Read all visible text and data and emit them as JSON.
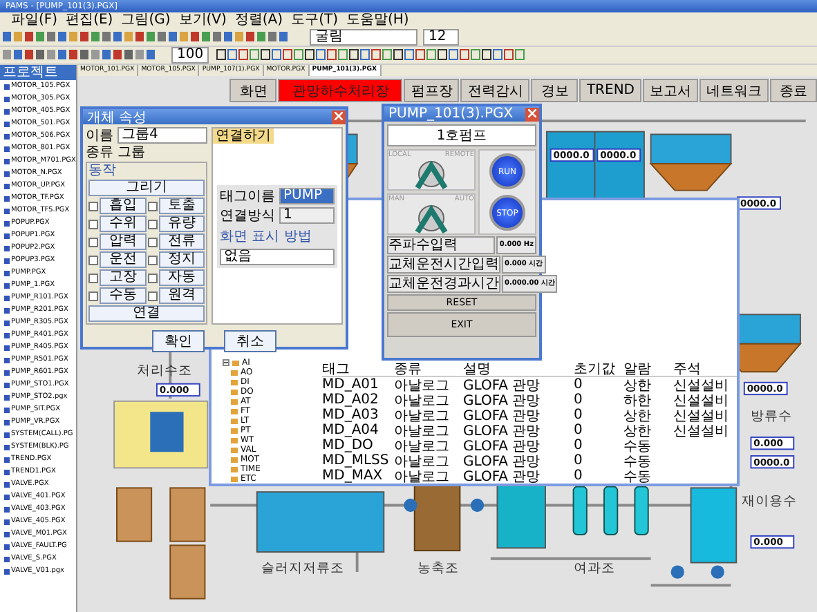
{
  "window": {
    "title": "PAMS - [PUMP_101(3).PGX]"
  },
  "menu": [
    "파일(F)",
    "편집(E)",
    "그림(G)",
    "보기(V)",
    "정렬(A)",
    "도구(T)",
    "도움말(H)"
  ],
  "toolbar": {
    "font_field": "굴림",
    "size_field": "12",
    "zoom_field": "100"
  },
  "doc_tabs": [
    {
      "label": "MOTOR_101.PGX",
      "selected": false
    },
    {
      "label": "MOTOR_105.PGX",
      "selected": false
    },
    {
      "label": "PUMP_107(1).PGX",
      "selected": false
    },
    {
      "label": "MOTOR.PGX",
      "selected": false
    },
    {
      "label": "PUMP_101(3).PGX",
      "selected": true
    }
  ],
  "project_panel": {
    "title": "프로젝트",
    "files": [
      "MOTOR_105.PGX",
      "MOTOR_305.PGX",
      "MOTOR_405.PGX",
      "MOTOR_501.PGX",
      "MOTOR_506.PGX",
      "MOTOR_801.PGX",
      "MOTOR_M701.PGX",
      "MOTOR_N.PGX",
      "MOTOR_UP.PGX",
      "MOTOR_TF.PGX",
      "MOTOR_TFS.PGX",
      "POPUP.PGX",
      "POPUP1.PGX",
      "POPUP2.PGX",
      "POPUP3.PGX",
      "PUMP.PGX",
      "PUMP_1.PGX",
      "PUMP_R101.PGX",
      "PUMP_R201.PGX",
      "PUMP_R305.PGX",
      "PUMP_R401.PGX",
      "PUMP_R405.PGX",
      "PUMP_R501.PGX",
      "PUMP_R601.PGX",
      "PUMP_STO1.PGX",
      "PUMP_STO2.pgx",
      "PUMP_SIT.PGX",
      "PUMP_VR.PGX",
      "SYSTEM(CALL).PG",
      "SYSTEM(BLK).PG",
      "TREND.PGX",
      "TREND1.PGX",
      "VALVE.PGX",
      "VALVE_401.PGX",
      "VALVE_403.PGX",
      "VALVE_405.PGX",
      "VALVE_M01.PGX",
      "VALVE_FAULT.PG",
      "VALVE_S.PGX",
      "VALVE_V01.pgx"
    ]
  },
  "nav_buttons": [
    {
      "label": "화면",
      "selected": false
    },
    {
      "label": "관망하수처리장",
      "selected": true
    },
    {
      "label": "펌프장",
      "selected": false
    },
    {
      "label": "전력감시",
      "selected": false
    },
    {
      "label": "경보",
      "selected": false
    },
    {
      "label": "TREND",
      "selected": false
    },
    {
      "label": "보고서",
      "selected": false
    },
    {
      "label": "네트워크",
      "selected": false
    },
    {
      "label": "종료",
      "selected": false
    }
  ],
  "property_dialog": {
    "title": "개체 속성",
    "name_label": "이름",
    "name_value": "그룹4",
    "type_label": "종류",
    "type_value": "그룹",
    "group_label": "동작",
    "header_button": "그리기",
    "options": [
      {
        "label": "흡입",
        "checked": false
      },
      {
        "label": "토출",
        "checked": false
      },
      {
        "label": "수위",
        "checked": false
      },
      {
        "label": "유량",
        "checked": false
      },
      {
        "label": "압력",
        "checked": false
      },
      {
        "label": "전류",
        "checked": false
      },
      {
        "label": "운전",
        "checked": false
      },
      {
        "label": "정지",
        "checked": false
      },
      {
        "label": "고장",
        "checked": false
      },
      {
        "label": "자동",
        "checked": false
      },
      {
        "label": "수동",
        "checked": false
      },
      {
        "label": "원격",
        "checked": false
      }
    ],
    "footer_button": "연결",
    "tab": "연결하기",
    "tag_label": "태그이름",
    "tag_value": "PUMP",
    "desc_label": "연결방식",
    "desc_value": "1",
    "sub_label": "화면 표시 방법",
    "select_value": "없음",
    "ok": "확인",
    "cancel": "취소"
  },
  "alarm_window": {
    "tree": [
      {
        "label": "AI",
        "expanded": true,
        "children": [
          {
            "label": "AO"
          },
          {
            "label": "DI"
          },
          {
            "label": "DO"
          },
          {
            "label": "AT"
          },
          {
            "label": "FT"
          },
          {
            "label": "LT"
          },
          {
            "label": "PT"
          },
          {
            "label": "WT"
          },
          {
            "label": "VAL"
          },
          {
            "label": "MOT"
          },
          {
            "label": "TIME"
          },
          {
            "label": "ETC"
          }
        ]
      }
    ],
    "columns": [
      "태그",
      "종류",
      "설명",
      "초기값",
      "알람",
      "주석"
    ],
    "rows": [
      {
        "tag": "MD_A01",
        "type": "아날로그",
        "desc": "GLOFA 관망",
        "init": "0",
        "alarm": "상한",
        "note": "신설설비"
      },
      {
        "tag": "MD_A02",
        "type": "아날로그",
        "desc": "GLOFA 관망",
        "init": "0",
        "alarm": "하한",
        "note": "신설설비"
      },
      {
        "tag": "MD_A03",
        "type": "아날로그",
        "desc": "GLOFA 관망",
        "init": "0",
        "alarm": "상한",
        "note": "신설설비"
      },
      {
        "tag": "MD_A04",
        "type": "아날로그",
        "desc": "GLOFA 관망",
        "init": "0",
        "alarm": "상한",
        "note": "신설설비"
      },
      {
        "tag": "MD_DO",
        "type": "아날로그",
        "desc": "GLOFA 관망",
        "init": "0",
        "alarm": "수동",
        "note": ""
      },
      {
        "tag": "MD_MLSS",
        "type": "아날로그",
        "desc": "GLOFA 관망",
        "init": "0",
        "alarm": "수동",
        "note": ""
      },
      {
        "tag": "MD_MAX",
        "type": "아날로그",
        "desc": "GLOFA 관망",
        "init": "0",
        "alarm": "수동",
        "note": ""
      }
    ]
  },
  "pump_popup": {
    "title": "PUMP_101(3).PGX",
    "name": "1호펌프",
    "local": "LOCAL",
    "remote": "REMOTE",
    "man": "MAN",
    "auto": "AUTO",
    "run": "RUN",
    "stop": "STOP",
    "run_on": true,
    "stop_on": true,
    "fields": [
      {
        "label": "주파수입력",
        "value": "0.000 Hz"
      },
      {
        "label": "교체운전시간입력",
        "value": "0.000 시간"
      },
      {
        "label": "교체운전경과시간",
        "value": "0.000.00 시간"
      }
    ],
    "reset": "RESET",
    "exit": "EXIT"
  },
  "labels": [
    {
      "text": "처리수조"
    },
    {
      "text": "방류수"
    },
    {
      "text": "슬러지저류조"
    },
    {
      "text": "농축조"
    },
    {
      "text": "여과조"
    },
    {
      "text": "재이용수"
    }
  ],
  "readouts": [
    "0000.0",
    "0000.0",
    "0000.0",
    "0.000",
    "0000.0",
    "0.000",
    "0000.0",
    "0.000"
  ]
}
